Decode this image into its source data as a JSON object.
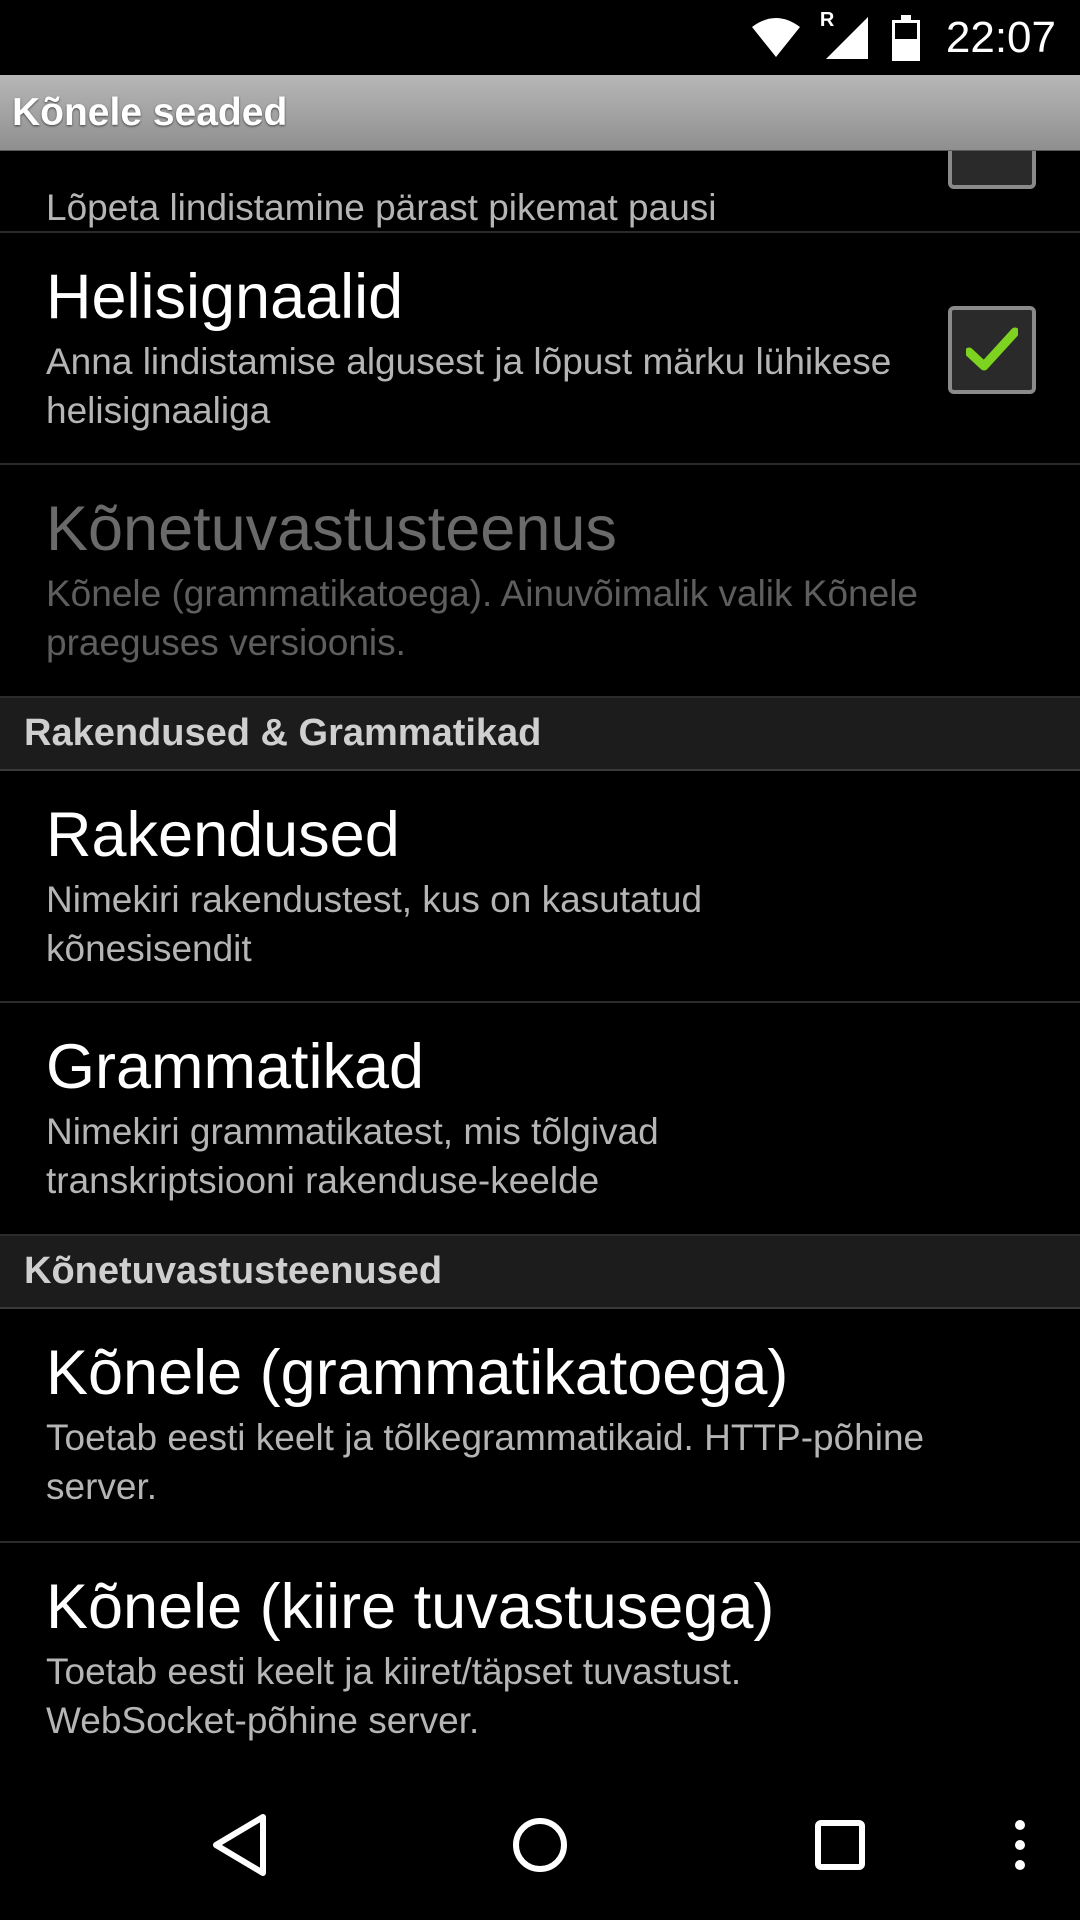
{
  "status_bar": {
    "time": "22:07",
    "roaming_indicator": "R",
    "icons": [
      "wifi-icon",
      "signal-icon",
      "battery-icon"
    ]
  },
  "app_bar": {
    "title": "Kõnele seaded"
  },
  "preferences": {
    "top_partial": {
      "summary": "Lõpeta lindistamine pärast pikemat pausi",
      "checked": false
    },
    "helisignaalid": {
      "title": "Helisignaalid",
      "summary": "Anna lindistamise algusest ja lõpust märku lühikese helisignaaliga",
      "checked": true
    },
    "konetuvastusteenus": {
      "title": "Kõnetuvastusteenus",
      "summary": "Kõnele (grammatikatoega). Ainuvõimalik valik Kõnele praeguses versioonis.",
      "enabled": false
    }
  },
  "categories": {
    "apps_grammars": "Rakendused & Grammatikad",
    "services": "Kõnetuvastusteenused"
  },
  "apps_grammars_items": {
    "rakendused": {
      "title": "Rakendused",
      "summary": "Nimekiri rakendustest, kus on kasutatud kõnesisendit"
    },
    "grammatikad": {
      "title": "Grammatikad",
      "summary": "Nimekiri grammatikatest, mis tõlgivad transkriptsiooni rakenduse-keelde"
    }
  },
  "service_items": {
    "grammar_service": {
      "title": "Kõnele (grammatikatoega)",
      "summary": "Toetab eesti keelt ja tõlkegrammatikaid. HTTP-põhine server."
    },
    "fast_service": {
      "title": "Kõnele (kiire tuvastusega)",
      "summary": "Toetab eesti keelt ja kiiret/täpset tuvastust. WebSocket-põhine server."
    }
  },
  "nav_bar": {
    "buttons": [
      "back-icon",
      "home-icon",
      "recents-icon",
      "overflow-menu-icon"
    ]
  },
  "colors": {
    "checkmark": "#7ed321",
    "background": "#000000",
    "app_bar": "#a3a3a3"
  }
}
